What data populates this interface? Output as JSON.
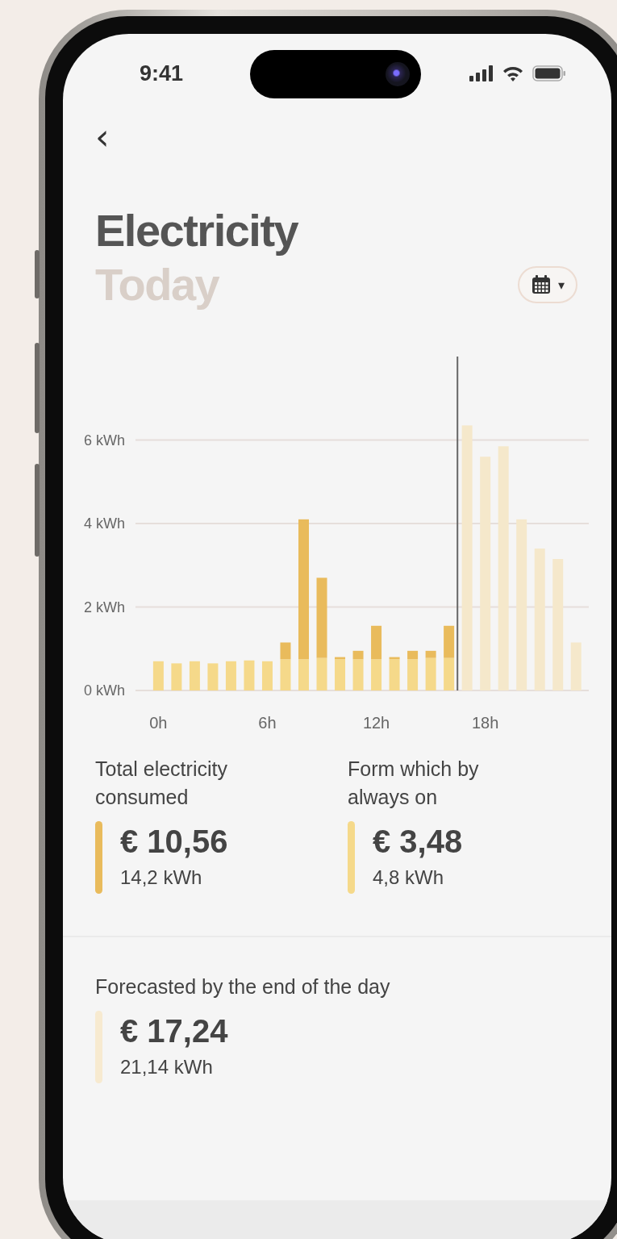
{
  "status_bar": {
    "time": "9:41"
  },
  "header": {
    "back": "‹",
    "title": "Electricity",
    "subtitle": "Today",
    "caret": "▾"
  },
  "chart": {
    "chart_data": {
      "type": "bar",
      "stacked": true,
      "x": [
        0,
        1,
        2,
        3,
        4,
        5,
        6,
        7,
        8,
        9,
        10,
        11,
        12,
        13,
        14,
        15,
        16,
        17,
        18,
        19,
        20,
        21,
        22,
        23
      ],
      "series": [
        {
          "color": "#f5d98a",
          "values": [
            0.7,
            0.65,
            0.7,
            0.65,
            0.7,
            0.72,
            0.7,
            0.75,
            0.75,
            0.78,
            0.75,
            0.75,
            0.75,
            0.75,
            0.75,
            0.78,
            0.78,
            null,
            null,
            null,
            null,
            null,
            null,
            null
          ]
        },
        {
          "color": "#e9bb5c",
          "values": [
            null,
            null,
            null,
            null,
            null,
            null,
            null,
            0.4,
            3.35,
            1.92,
            0.05,
            0.2,
            0.8,
            0.05,
            0.2,
            0.17,
            0.77,
            null,
            null,
            null,
            null,
            null,
            null,
            null
          ]
        },
        {
          "color": "#f5e8cb",
          "values": [
            null,
            null,
            null,
            null,
            null,
            null,
            null,
            null,
            null,
            null,
            null,
            null,
            null,
            null,
            null,
            null,
            null,
            6.35,
            5.6,
            5.85,
            4.1,
            3.4,
            3.15,
            1.15
          ]
        }
      ],
      "ylim": [
        0,
        8
      ],
      "xlim": [
        -1.26,
        23.7
      ],
      "grid": true,
      "ref_lines": [
        {
          "axis": "x",
          "value": 16.47
        }
      ],
      "yticks": [
        {
          "value": 0,
          "label": "0 kWh"
        },
        {
          "value": 2,
          "label": "2 kWh"
        },
        {
          "value": 4,
          "label": "4 kWh"
        },
        {
          "value": 6,
          "label": "6 kWh"
        }
      ],
      "xticks": [
        {
          "value": 0,
          "label": "0h"
        },
        {
          "value": 6,
          "label": "6h"
        },
        {
          "value": 12,
          "label": "12h"
        },
        {
          "value": 18,
          "label": "18h"
        }
      ]
    }
  },
  "stats": [
    {
      "label": "Total electricity consumed",
      "value": "€ 10,56",
      "energy": "14,2 kWh",
      "color": "#e9bb5c"
    },
    {
      "label": "Form which by always on",
      "value": "€ 3,48",
      "energy": "4,8 kWh",
      "color": "#f5d98a"
    }
  ],
  "forecast": {
    "label": "Forecasted by the end of the day",
    "value": "€ 17,24",
    "energy": "21,14 kWh",
    "color": "#f7ead0"
  }
}
